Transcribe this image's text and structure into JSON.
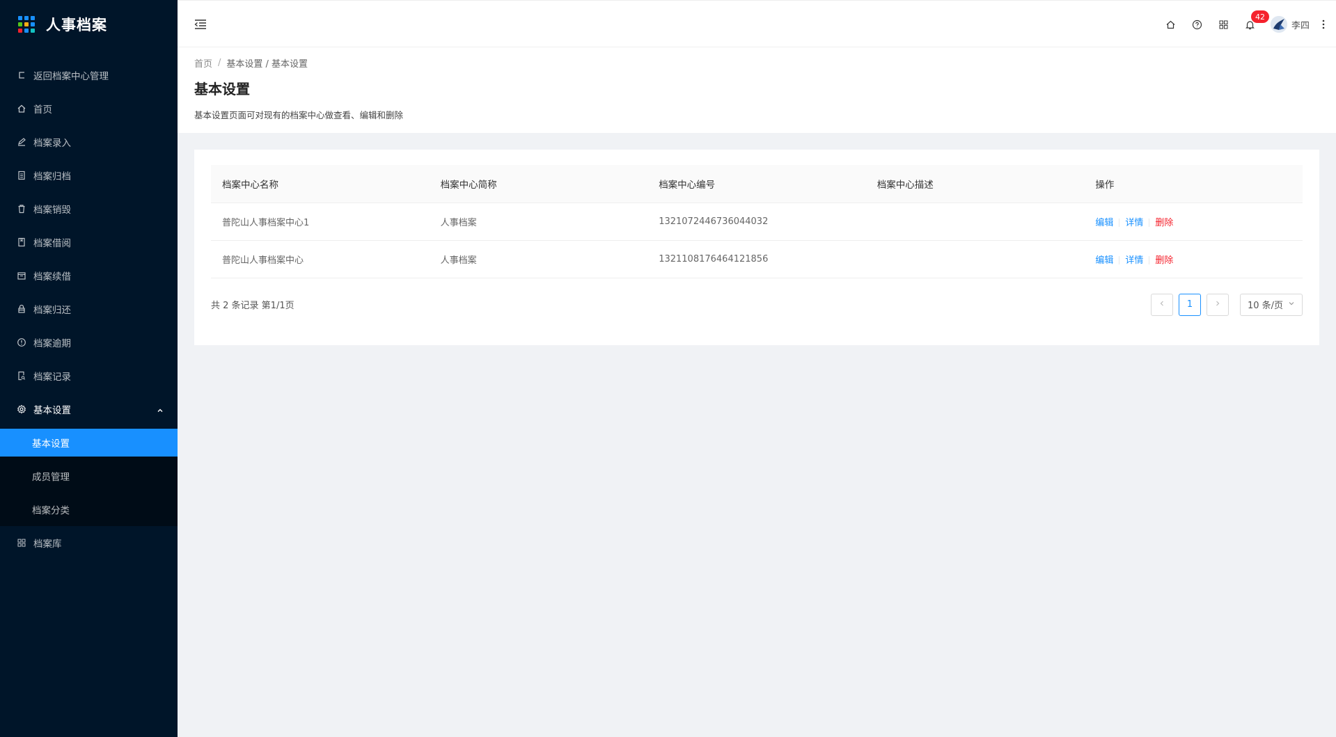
{
  "app": {
    "title": "人事档案",
    "logo_dot_colors": [
      "#1890ff",
      "#1890ff",
      "#1890ff",
      "#52c41a",
      "#faad14",
      "#1890ff",
      "#f5222d",
      "#1890ff",
      "#13c2c2"
    ]
  },
  "sidebar": {
    "items": [
      {
        "label": "返回档案中心管理",
        "icon": "return-icon"
      },
      {
        "label": "首页",
        "icon": "home-icon"
      },
      {
        "label": "档案录入",
        "icon": "edit-icon"
      },
      {
        "label": "档案归档",
        "icon": "file-icon"
      },
      {
        "label": "档案销毁",
        "icon": "delete-icon"
      },
      {
        "label": "档案借阅",
        "icon": "book-icon"
      },
      {
        "label": "档案续借",
        "icon": "calendar-icon"
      },
      {
        "label": "档案归还",
        "icon": "lock-icon"
      },
      {
        "label": "档案逾期",
        "icon": "exclamation-circle-icon"
      },
      {
        "label": "档案记录",
        "icon": "file-search-icon"
      }
    ],
    "settings": {
      "label": "基本设置",
      "icon": "gear-icon",
      "children": [
        {
          "label": "基本设置"
        },
        {
          "label": "成员管理"
        },
        {
          "label": "档案分类"
        }
      ]
    },
    "library": {
      "label": "档案库",
      "icon": "appstore-icon"
    }
  },
  "header": {
    "notification_count": "42",
    "username": "李四",
    "accent": "#1890ff"
  },
  "breadcrumb": {
    "home": "首页",
    "sep": "/",
    "path": "基本设置 / 基本设置"
  },
  "page": {
    "title": "基本设置",
    "description": "基本设置页面可对现有的档案中心做查看、编辑和删除"
  },
  "table": {
    "columns": [
      "档案中心名称",
      "档案中心简称",
      "档案中心编号",
      "档案中心描述",
      "操作"
    ],
    "rows": [
      {
        "name": "普陀山人事档案中心1",
        "short": "人事档案",
        "code": "1321072446736044032",
        "desc": ""
      },
      {
        "name": "普陀山人事档案中心",
        "short": "人事档案",
        "code": "1321108176464121856",
        "desc": ""
      }
    ],
    "actions": {
      "edit": "编辑",
      "detail": "详情",
      "delete": "删除"
    }
  },
  "pagination": {
    "summary": "共 2 条记录 第1/1页",
    "current": "1",
    "page_size": "10 条/页"
  }
}
